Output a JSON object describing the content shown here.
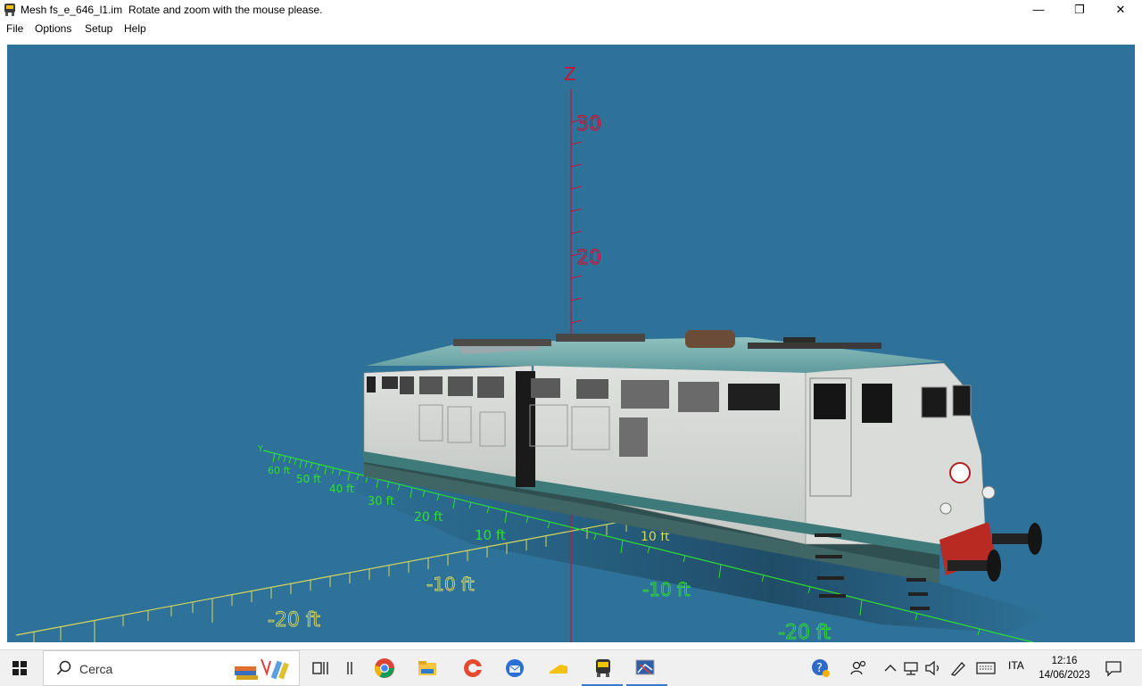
{
  "window": {
    "title": "Mesh fs_e_646_l1.im",
    "hint": "Rotate and zoom with the mouse please.",
    "controls": {
      "minimize": "—",
      "maximize": "❐",
      "close": "✕"
    }
  },
  "menu": [
    "File",
    "Options",
    "Setup",
    "Help"
  ],
  "viewport": {
    "background": "#2e7299",
    "z_axis": {
      "label": "Z",
      "ticks": [
        "30",
        "20"
      ],
      "color": "#cc1133"
    },
    "x_axis": {
      "labels": [
        "10 ft",
        "-10 ft",
        "-20 ft"
      ],
      "color": "#d7d75a"
    },
    "y_axis": {
      "label": "Y",
      "labels": [
        "60 ft",
        "50 ft",
        "40 ft",
        "30 ft",
        "20 ft",
        "10 ft",
        "-10 ft",
        "-20 ft"
      ],
      "color": "#2ee02e"
    },
    "model": "electric locomotive fs e646"
  },
  "taskbar": {
    "search_placeholder": "Cerca",
    "language": "ITA",
    "time": "12:16",
    "date": "14/06/2023",
    "icons": [
      "start-icon",
      "task-view-icon",
      "chrome-icon",
      "file-explorer-icon",
      "ccleaner-icon",
      "thunderbird-icon",
      "sticky-icon",
      "train-app-icon",
      "mesh-viewer-icon"
    ]
  }
}
